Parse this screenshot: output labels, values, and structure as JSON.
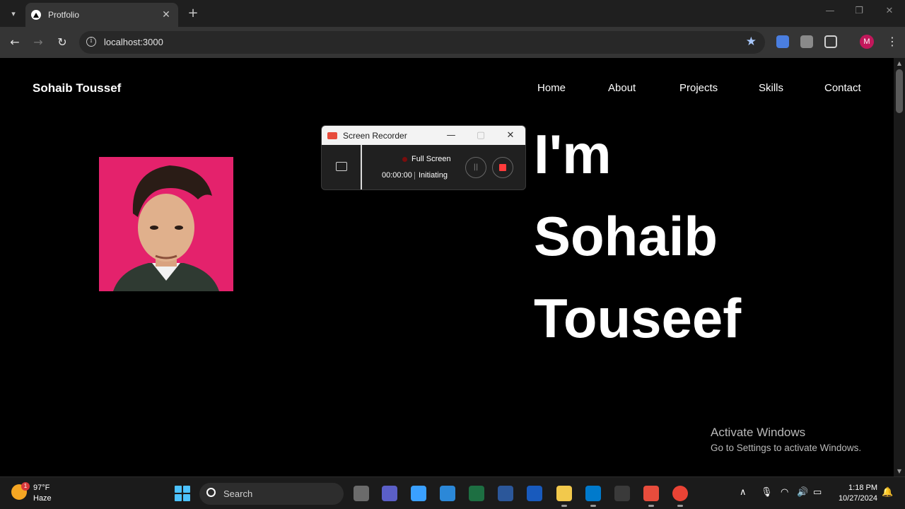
{
  "browser": {
    "tab_title": "Protfolio",
    "url": "localhost:3000",
    "profile_initial": "M"
  },
  "site": {
    "brand": "Sohaib Toussef",
    "nav": [
      "Home",
      "About",
      "Projects",
      "Skills",
      "Contact"
    ],
    "hero_lines": [
      "I'm",
      "Sohaib",
      "Touseef"
    ]
  },
  "watermark": {
    "title": "Activate Windows",
    "subtitle": "Go to Settings to activate Windows."
  },
  "recorder": {
    "title": "Screen Recorder",
    "mode": "Full Screen",
    "time": "00:00:00",
    "status": "Initiating",
    "pause_symbol": "||"
  },
  "taskbar": {
    "weather_badge": "1",
    "weather_temp": "97°F",
    "weather_desc": "Haze",
    "search_placeholder": "Search",
    "clock_time": "1:18 PM",
    "clock_date": "10/27/2024",
    "apps": [
      {
        "name": "file-explorer-mini-icon",
        "color": "#6b6b6b"
      },
      {
        "name": "teams-icon",
        "color": "#5b5fc7"
      },
      {
        "name": "copilot-icon",
        "color": "#3aa0ff"
      },
      {
        "name": "app-icon",
        "color": "#2b88d8"
      },
      {
        "name": "excel-icon",
        "color": "#1d6f42"
      },
      {
        "name": "word-outline-icon",
        "color": "#2b579a"
      },
      {
        "name": "word-icon",
        "color": "#185abd"
      },
      {
        "name": "folder-icon",
        "color": "#f2c94c"
      },
      {
        "name": "vscode-icon",
        "color": "#007acc"
      },
      {
        "name": "terminal-icon",
        "color": "#3a3a3a"
      },
      {
        "name": "screen-recorder-icon",
        "color": "#e74c3c"
      },
      {
        "name": "chrome-icon",
        "color": "#ea4335"
      }
    ]
  },
  "colors": {
    "profile_bg": "#e4226c",
    "accent": "#4cc2ff",
    "record_stop": "#ff3b3b"
  }
}
